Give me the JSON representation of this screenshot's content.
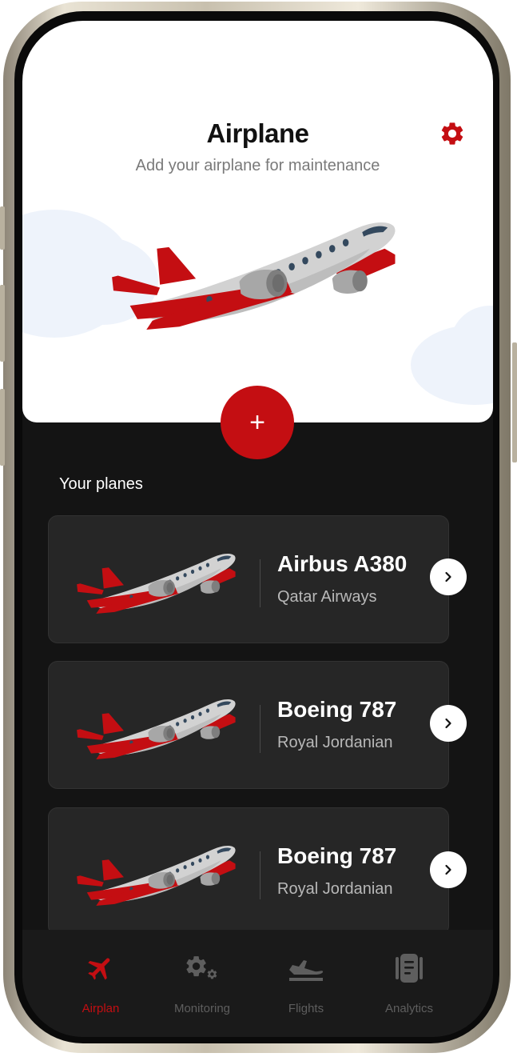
{
  "header": {
    "title": "Airplane",
    "subtitle": "Add your airplane for maintenance",
    "settings_icon": "gear-icon"
  },
  "add_button": {
    "label": "+"
  },
  "section": {
    "title": "Your planes"
  },
  "planes": [
    {
      "name": "Airbus A380",
      "airline": "Qatar Airways"
    },
    {
      "name": "Boeing 787",
      "airline": "Royal Jordanian"
    },
    {
      "name": "Boeing 787",
      "airline": "Royal Jordanian"
    }
  ],
  "nav": {
    "items": [
      {
        "label": "Airplan",
        "icon": "airplane-icon",
        "active": true
      },
      {
        "label": "Monitoring",
        "icon": "gears-icon",
        "active": false
      },
      {
        "label": "Flights",
        "icon": "departure-icon",
        "active": false
      },
      {
        "label": "Analytics",
        "icon": "document-icon",
        "active": false
      }
    ]
  },
  "colors": {
    "accent": "#c40e12",
    "background": "#141414",
    "card": "#262626",
    "inactive": "#5e5e5e"
  }
}
